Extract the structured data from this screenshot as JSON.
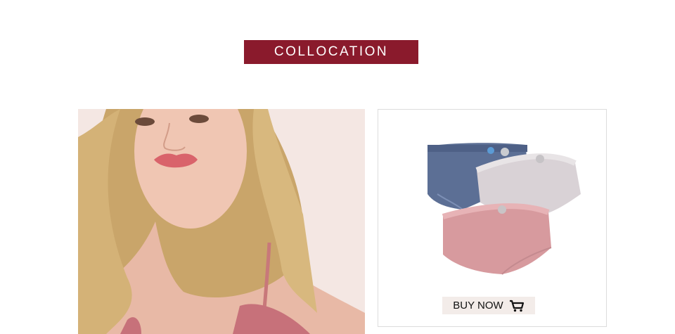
{
  "banner": {
    "title": "COLLOCATION"
  },
  "model_photo": {
    "icon": "model-photo"
  },
  "product": {
    "colors": [
      "#5c6f95",
      "#d9d2d6",
      "#d79a9e"
    ],
    "buy_label": "BUY NOW",
    "buy_icon": "shopping-cart-icon"
  },
  "colors": {
    "banner_bg": "#8a1a2c",
    "button_bg": "#f3ece9"
  }
}
